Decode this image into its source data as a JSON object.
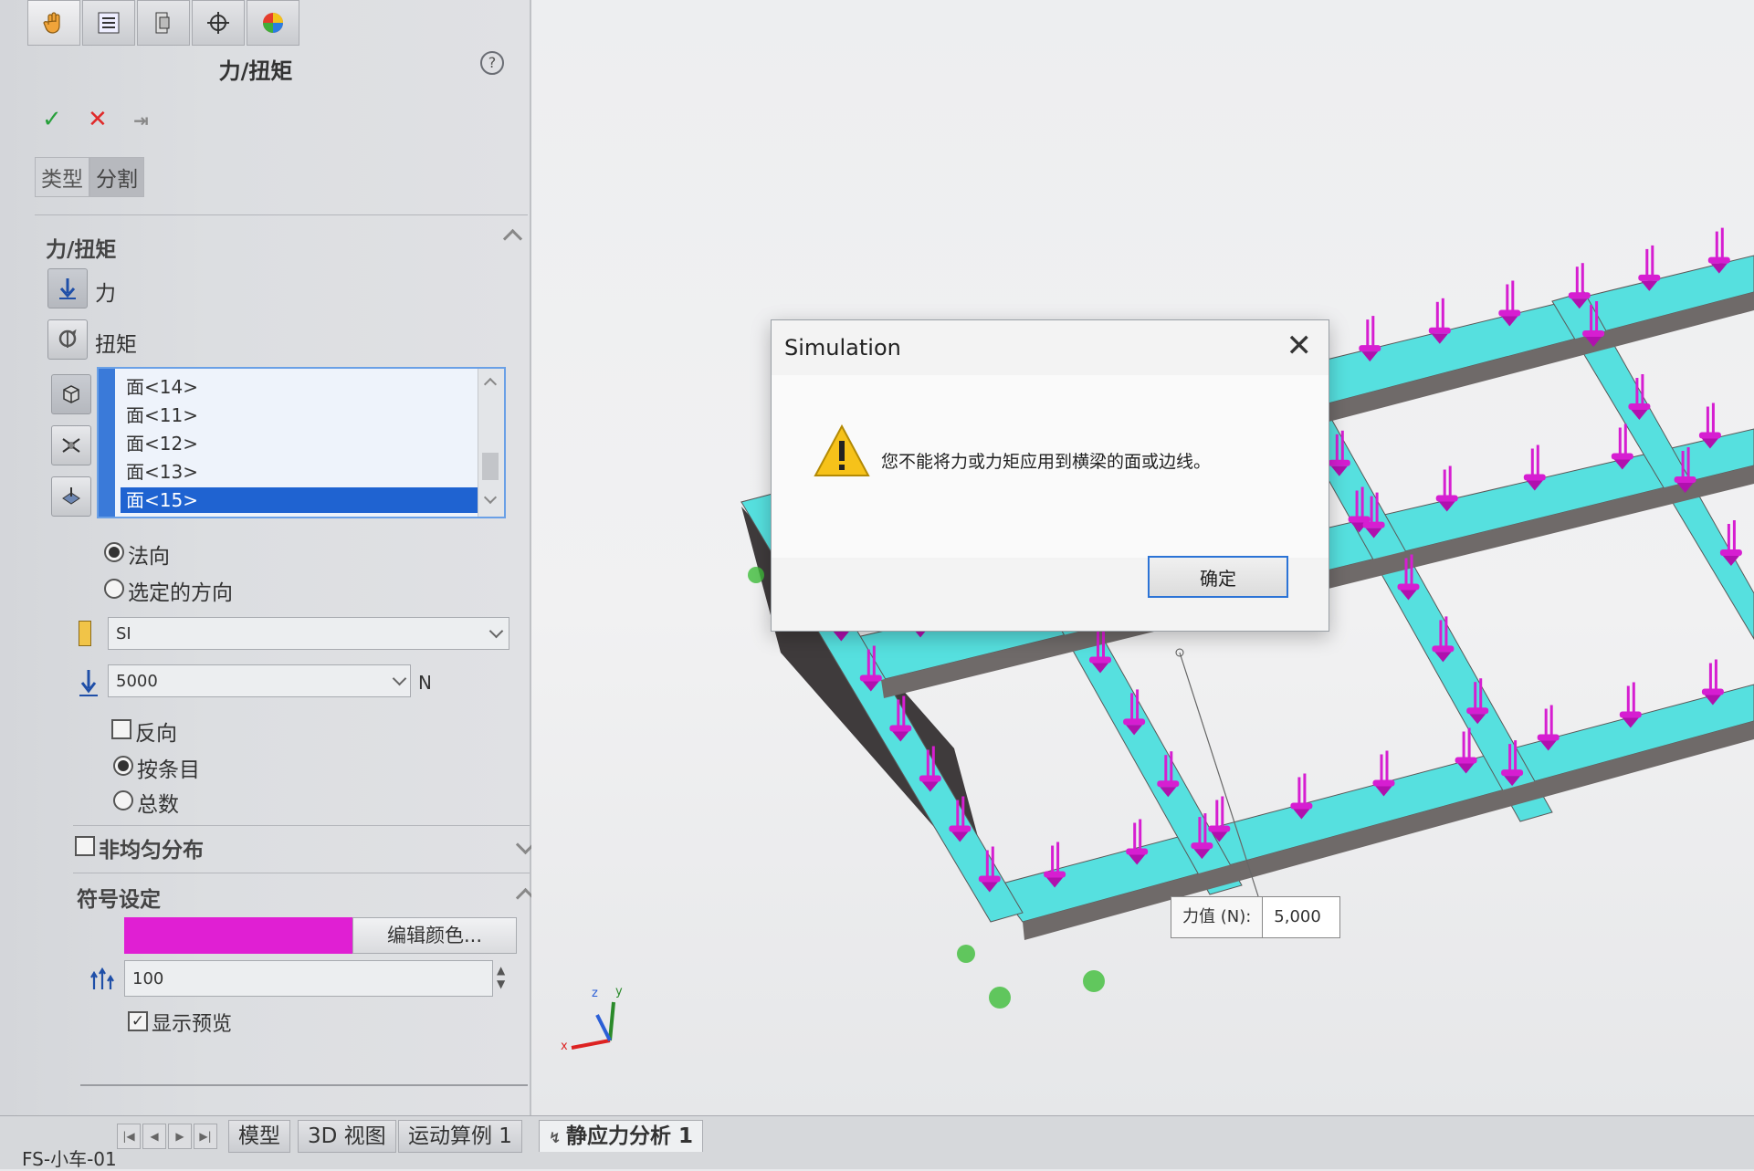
{
  "panel": {
    "title": "力/扭矩",
    "tabs": [
      "类型",
      "分割"
    ],
    "section_force_torque": {
      "title": "力/扭矩",
      "force_label": "力",
      "torque_label": "扭矩",
      "faces": [
        "面<14>",
        "面<11>",
        "面<12>",
        "面<13>",
        "面<15>"
      ],
      "direction_options": [
        "法向",
        "选定的方向"
      ],
      "unit_system": "SI",
      "force_value": "5000",
      "force_unit": "N",
      "reverse_label": "反向",
      "distribution_options": [
        "按条目",
        "总数"
      ]
    },
    "nonuniform_label": "非均匀分布",
    "symbol_settings": {
      "title": "符号设定",
      "edit_color_label": "编辑颜色...",
      "symbol_size": "100",
      "show_preview_label": "显示预览",
      "color": "#e01fd3"
    }
  },
  "bottom_tabs": [
    "模型",
    "3D 视图",
    "运动算例 1",
    "静应力分析 1"
  ],
  "status_text": "FS-小车-01",
  "dialog": {
    "title": "Simulation",
    "message": "您不能将力或力矩应用到横梁的面或边线。",
    "ok_label": "确定",
    "icon": "warning-icon"
  },
  "tooltip": {
    "label": "力值 (N):",
    "value": "5,000"
  },
  "triad": {
    "x": "x",
    "y": "y",
    "z": "z"
  },
  "colors": {
    "beam": "#56e0df",
    "load_arrow": "#d61ed1",
    "fixture": "#3fbe3a",
    "selection": "#1f63d1",
    "dialog_ok_border": "#2b73d6"
  }
}
